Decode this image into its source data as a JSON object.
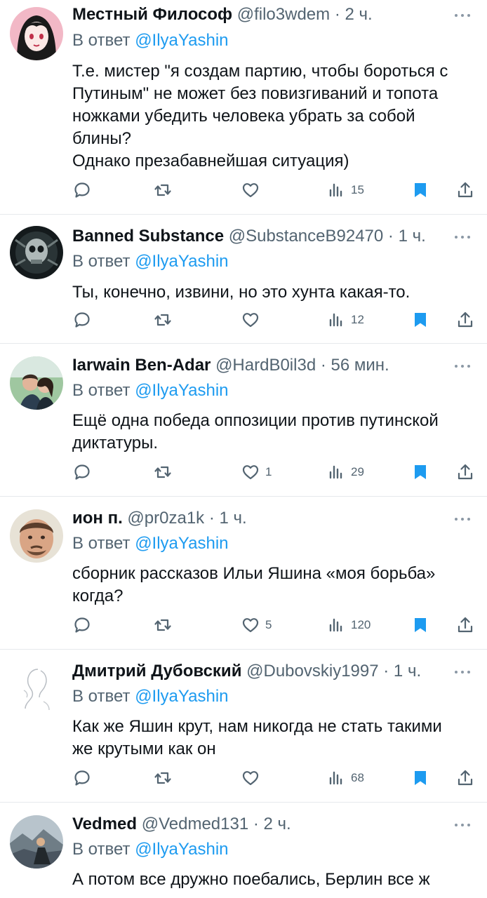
{
  "colors": {
    "accent": "#1d9bf0",
    "text": "#0f1419",
    "muted": "#536471",
    "bookmark": "#1d9bf0",
    "divider": "#e6e9ec"
  },
  "tweets": [
    {
      "name": "Местный Философ",
      "handle": "@filo3wdem",
      "sep": " · ",
      "time": "2 ч.",
      "reply_prefix": "В ответ ",
      "reply_to": "@IlyaYashin",
      "lines": [
        "Т.е. мистер \"я создам партию, чтобы бороться с",
        "Путиным\" не может без повизгиваний и топота",
        "ножками убедить человека убрать за собой",
        "блины?",
        "Однако презабавнейшая ситуация)"
      ],
      "likes": "",
      "views": "15",
      "avatar_icon": "anime-avatar-icon"
    },
    {
      "name": "Banned Substance",
      "handle": "@SubstanceB92470",
      "sep": " · ",
      "time": "1 ч.",
      "reply_prefix": "В ответ ",
      "reply_to": "@IlyaYashin",
      "lines": [
        "Ты, конечно, извини, но это хунта какая-то."
      ],
      "likes": "",
      "views": "12",
      "avatar_icon": "skull-avatar-icon"
    },
    {
      "name": "Iarwain Ben-Adar",
      "handle": "@HardB0il3d",
      "sep": " · ",
      "time": "56 мин.",
      "reply_prefix": "В ответ ",
      "reply_to": "@IlyaYashin",
      "lines": [
        "Ещё одна победа оппозиции против путинской",
        "диктатуры."
      ],
      "likes": "1",
      "views": "29",
      "avatar_icon": "couple-photo-icon"
    },
    {
      "name": "ион п.",
      "handle": "@pr0za1k",
      "sep": " · ",
      "time": "1 ч.",
      "reply_prefix": "В ответ ",
      "reply_to": "@IlyaYashin",
      "lines": [
        "сборник рассказов Ильи Яшина «моя борьба»",
        "когда?"
      ],
      "likes": "5",
      "views": "120",
      "avatar_icon": "face-photo-icon"
    },
    {
      "name": "Дмитрий Дубовский",
      "handle": "@Dubovskiy1997",
      "sep": " · ",
      "time": "1 ч.",
      "reply_prefix": "В ответ ",
      "reply_to": "@IlyaYashin",
      "lines": [
        "Как же Яшин крут, нам никогда не стать такими",
        "же крутыми как он"
      ],
      "likes": "",
      "views": "68",
      "avatar_icon": "sketch-avatar-icon"
    },
    {
      "name": "Vedmed",
      "handle": "@Vedmed131",
      "sep": " · ",
      "time": "2 ч.",
      "reply_prefix": "В ответ ",
      "reply_to": "@IlyaYashin",
      "lines": [
        "А потом все дружно поебались, Берлин все ж"
      ],
      "likes": "",
      "views": "",
      "avatar_icon": "landscape-photo-icon"
    }
  ]
}
